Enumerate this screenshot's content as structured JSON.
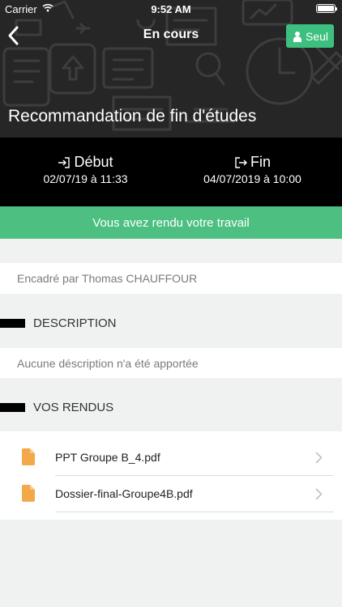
{
  "status_bar": {
    "carrier": "Carrier",
    "time": "9:52 AM"
  },
  "nav": {
    "title": "En cours",
    "solo_button": "Seul"
  },
  "assignment": {
    "title": "Recommandation de fin d'études"
  },
  "dates": {
    "start_label": "Début",
    "start_value": "02/07/19 à 11:33",
    "end_label": "Fin",
    "end_value": "04/07/2019 à 10:00"
  },
  "banner": {
    "text": "Vous avez rendu votre travail"
  },
  "supervisor": {
    "text": "Encadré par Thomas CHAUFFOUR"
  },
  "description": {
    "heading": "DESCRIPTION",
    "text": "Aucune déscription n'a été apportée"
  },
  "submissions": {
    "heading": "VOS RENDUS",
    "files": [
      {
        "name": "PPT Groupe B_4.pdf"
      },
      {
        "name": "Dossier-final-Groupe4B.pdf"
      }
    ]
  },
  "colors": {
    "accent_green": "#4cbf81",
    "file_icon": "#f3a94a",
    "header_bg": "#262626"
  }
}
